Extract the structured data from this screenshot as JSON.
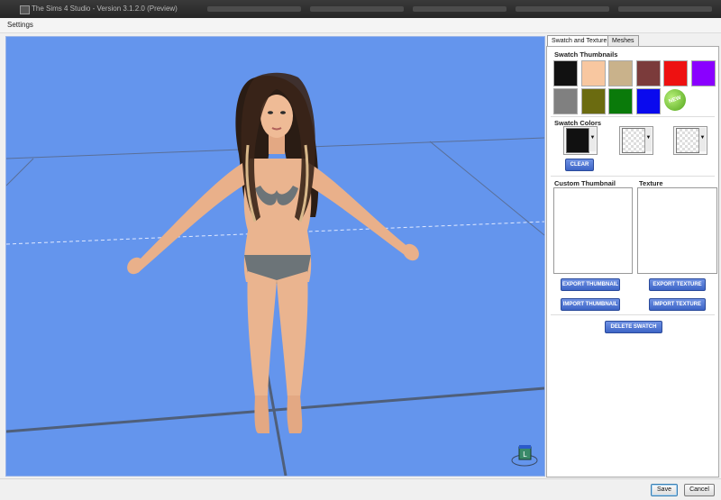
{
  "window": {
    "title": "The Sims 4 Studio - Version 3.1.2.0 (Preview)"
  },
  "menu": {
    "settings_label": "Settings"
  },
  "viewport": {
    "background_color": "#6495ed",
    "orientation_gizmo_label": "L"
  },
  "panel": {
    "tabs": [
      {
        "label": "Swatch and Texture",
        "active": true
      },
      {
        "label": "Meshes",
        "active": false
      }
    ],
    "swatch_thumbnails": {
      "title": "Swatch Thumbnails",
      "colors": [
        "#111111",
        "#f8c7a0",
        "#c9b28b",
        "#7b3b3b",
        "#ee1111",
        "#8a00ff",
        "#808080",
        "#6b6b10",
        "#0a7a0a",
        "#0a0aee"
      ],
      "new_badge": "NEW"
    },
    "swatch_colors": {
      "title": "Swatch Colors",
      "selected_color": "#111111",
      "clear_label": "CLEAR"
    },
    "custom_thumbnail": {
      "title": "Custom Thumbnail",
      "export_label": "EXPORT THUMBNAIL",
      "import_label": "IMPORT THUMBNAIL"
    },
    "texture": {
      "title": "Texture",
      "export_label": "EXPORT TEXTURE",
      "import_label": "IMPORT TEXTURE"
    },
    "delete_swatch_label": "DELETE SWATCH"
  },
  "footer": {
    "save_label": "Save",
    "cancel_label": "Cancel"
  }
}
